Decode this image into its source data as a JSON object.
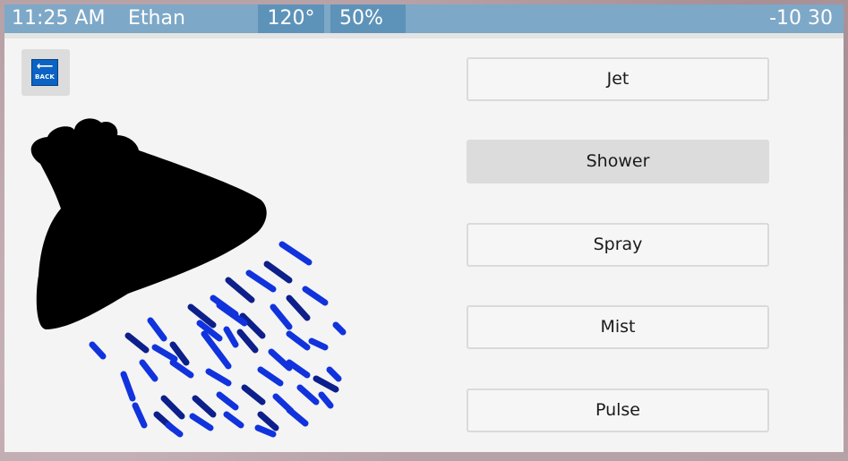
{
  "status_bar": {
    "time": "11:25 AM",
    "user": "Ethan",
    "temperature": "120°",
    "pressure": "50%",
    "right_text": "-10 30"
  },
  "back_button": {
    "label": "BACK",
    "arrow": "⟵",
    "icon": "back-arrow-icon"
  },
  "illustration": {
    "icon": "shower-head-icon",
    "head_color": "#000000",
    "water_color": "#1133dd",
    "water_dark_color": "#0d1f8a"
  },
  "modes": [
    {
      "label": "Jet",
      "selected": false
    },
    {
      "label": "Shower",
      "selected": true
    },
    {
      "label": "Spray",
      "selected": false
    },
    {
      "label": "Mist",
      "selected": false
    },
    {
      "label": "Pulse",
      "selected": false
    }
  ],
  "colors": {
    "status_bar": "#7ea8c7",
    "status_highlight": "#5e93b9",
    "panel": "#f4f4f4",
    "selected_button": "#dcdcdc"
  }
}
